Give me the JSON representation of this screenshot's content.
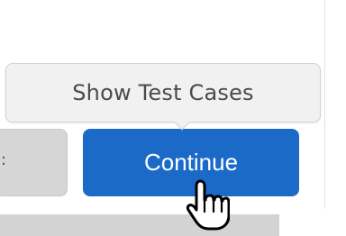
{
  "tooltip": {
    "text": "Show Test Cases"
  },
  "buttons": {
    "continue_label": "Continue",
    "left_partial_label": ":"
  },
  "icons": {
    "cursor": "hand-pointer-icon"
  },
  "colors": {
    "primary": "#1c6ac8",
    "tooltip_bg": "#f1f1f1",
    "secondary_button_bg": "#d6d6d6"
  }
}
